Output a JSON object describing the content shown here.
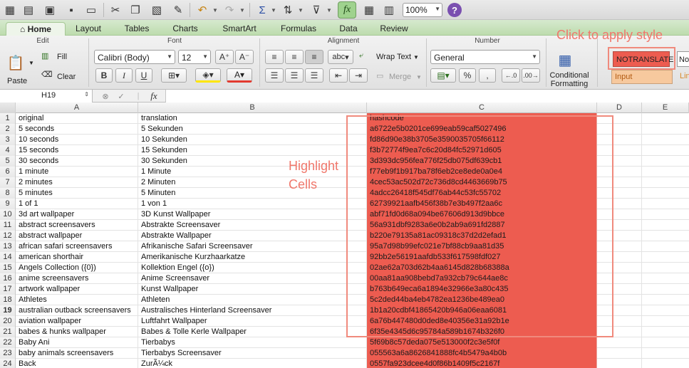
{
  "window": {
    "zoom": "100%"
  },
  "icons": [
    "grid-icon",
    "new-icon",
    "open-icon",
    "save-icon",
    "print-icon",
    "cut-icon",
    "copy-icon",
    "paste-icon",
    "format-painter-icon",
    "undo-icon",
    "redo-icon",
    "autosum-icon",
    "sort-icon",
    "filter-icon",
    "fx-icon",
    "gallery-icon",
    "help-icon"
  ],
  "fx_symbol": "fx",
  "help_symbol": "?",
  "tabs": [
    {
      "label": "Home",
      "active": true
    },
    {
      "label": "Layout"
    },
    {
      "label": "Tables"
    },
    {
      "label": "Charts"
    },
    {
      "label": "SmartArt"
    },
    {
      "label": "Formulas"
    },
    {
      "label": "Data"
    },
    {
      "label": "Review"
    }
  ],
  "ribbon": {
    "groups": {
      "edit": "Edit",
      "font": "Font",
      "alignment": "Alignment",
      "number": "Number"
    },
    "paste": "Paste",
    "fill": "Fill",
    "clear": "Clear",
    "font_name": "Calibri (Body)",
    "font_size": "12",
    "bold": "B",
    "italic": "I",
    "underline": "U",
    "wrap_text": "Wrap Text",
    "merge": "Merge",
    "number_format": "General",
    "conditional_formatting": [
      "Conditional",
      "Formatting"
    ],
    "orientation": "abc",
    "percent": "%",
    "comma": ","
  },
  "styles": {
    "notranslate": "NOTRANSLATE",
    "input": "Input",
    "normal": "Normal",
    "linked": "Linked"
  },
  "accent": "#ed5c50",
  "formula_bar": {
    "cell_ref": "H19",
    "fx": "fx",
    "value": ""
  },
  "columns": [
    "A",
    "B",
    "C",
    "D",
    "E"
  ],
  "rows": [
    {
      "n": "1",
      "a": "original",
      "b": "translation",
      "c": "hashcode"
    },
    {
      "n": "2",
      "a": "5 seconds",
      "b": "5 Sekunden",
      "c": "a6722e5b0201ce699eab59caf5027496"
    },
    {
      "n": "3",
      "a": "10 seconds",
      "b": "10 Sekunden",
      "c": "fd86d90e38b3705e3590035705f66112"
    },
    {
      "n": "4",
      "a": "15 seconds",
      "b": "15 Sekunden",
      "c": "f3b72774f9ea7c6c20d84fc52971d605"
    },
    {
      "n": "5",
      "a": "30 seconds",
      "b": "30 Sekunden",
      "c": "3d393dc956fea776f25db075df639cb1"
    },
    {
      "n": "6",
      "a": "1 minute",
      "b": "1 Minute",
      "c": "f77eb9f1b917ba78f6eb2ce8ede0a0e4"
    },
    {
      "n": "7",
      "a": "2 minutes",
      "b": "2 Minuten",
      "c": "4cec53ac502d72c736d8cd4463669b75"
    },
    {
      "n": "8",
      "a": "5 minutes",
      "b": "5 Minuten",
      "c": "4adcc26418f545df76ab44c53fc55702"
    },
    {
      "n": "9",
      "a": "1 of 1",
      "b": "1 von 1",
      "c": "62739921aafb456f38b7e3b497f2aa6c"
    },
    {
      "n": "10",
      "a": "3d art wallpaper",
      "b": "3D Kunst Wallpaper",
      "c": "abf71fd0d68a094be67606d913d9bbce"
    },
    {
      "n": "11",
      "a": "abstract screensavers",
      "b": "Abstrakte Screensaver",
      "c": "56a931dbf9283a6e0b2ab9a691fd2887"
    },
    {
      "n": "12",
      "a": "abstract wallpaper",
      "b": "Abstrakte Wallpaper",
      "c": "b220e79135a81ac09318c37d2d2efad1"
    },
    {
      "n": "13",
      "a": "african safari screensavers",
      "b": "Afrikanische Safari Screensaver",
      "c": "95a7d98b99efc021e7bf88cb9aa81d35"
    },
    {
      "n": "14",
      "a": "american shorthair",
      "b": "Amerikanische Kurzhaarkatze",
      "c": "92bb2e56191aafdb533f617598fdf027"
    },
    {
      "n": "15",
      "a": "Angels Collection ({0})",
      "b": "Kollektion Engel ({o})",
      "c": "02ae62a703d62b4aa6145d828b68388a"
    },
    {
      "n": "16",
      "a": "anime screensavers",
      "b": "Anime Screensaver",
      "c": "00aa81aa908bebd7a932cb79c644ae8c"
    },
    {
      "n": "17",
      "a": "artwork wallpaper",
      "b": "Kunst Wallpaper",
      "c": "b763b649eca6a1894e32966e3a80c435"
    },
    {
      "n": "18",
      "a": "Athletes",
      "b": "Athleten",
      "c": "5c2ded44ba4eb4782ea1236be489ea0"
    },
    {
      "n": "19",
      "a": "australian outback screensavers",
      "b": "Australisches Hinterland Screensaver",
      "c": "1b1a20cdbf41865420b946a06eaa6081",
      "bold": true
    },
    {
      "n": "20",
      "a": "aviation wallpaper",
      "b": "Luftfahrt Wallpaper",
      "c": "6a76b447480d0ded8e40356e31a92b1e"
    },
    {
      "n": "21",
      "a": "babes & hunks wallpaper",
      "b": "Babes & Tolle Kerle Wallpaper",
      "c": "6f35e4345d6c95784a589b1674b326f0"
    },
    {
      "n": "22",
      "a": "Baby Ani",
      "b": "Tierbabys",
      "c": "5f69b8c57deda075e513000f2c3e5f0f"
    },
    {
      "n": "23",
      "a": "baby animals screensavers",
      "b": "Tierbabys Screensaver",
      "c": "055563a6a8626841888fc4b5479a4b0b"
    },
    {
      "n": "24",
      "a": "Back",
      "b": "ZurÃ¼ck",
      "c": "0557fa923dcee4d0f86b1409f5c2167f"
    }
  ],
  "annotations": {
    "apply_style": "Click to apply style",
    "highlight": "Highlight",
    "cells": "Cells"
  }
}
